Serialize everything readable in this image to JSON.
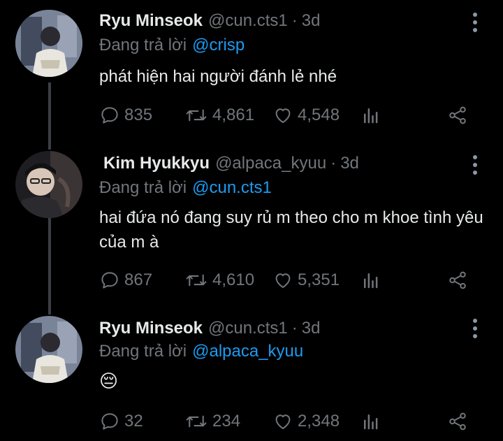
{
  "colors": {
    "background": "#000000",
    "text": "#e7e9ea",
    "muted": "#71767b",
    "mention": "#1d9bf0",
    "thread_line": "#3b3f44"
  },
  "tweets": [
    {
      "display_name": "Ryu Minseok",
      "handle": "@cun.cts1",
      "separator": "·",
      "time": "3d",
      "reply_prefix": "Đang trả lời",
      "reply_to": "@crisp",
      "text": "phát hiện hai người đánh lẻ nhé",
      "replies": "835",
      "retweets": "4,861",
      "likes": "4,548",
      "icons": [
        "reply-icon",
        "retweet-icon",
        "like-icon",
        "stats-icon",
        "share-icon",
        "more-icon"
      ]
    },
    {
      "display_name": "Kim Hyukkyu",
      "handle": "@alpaca_kyuu",
      "separator": "·",
      "time": "3d",
      "reply_prefix": "Đang trả lời",
      "reply_to": "@cun.cts1",
      "text": "hai đứa nó đang suy rủ m theo cho m khoe tình yêu của m à",
      "replies": "867",
      "retweets": "4,610",
      "likes": "5,351",
      "icons": [
        "reply-icon",
        "retweet-icon",
        "like-icon",
        "stats-icon",
        "share-icon",
        "more-icon"
      ]
    },
    {
      "display_name": "Ryu Minseok",
      "handle": "@cun.cts1",
      "separator": "·",
      "time": "3d",
      "reply_prefix": "Đang trả lời",
      "reply_to": "@alpaca_kyuu",
      "text": "😔",
      "replies": "32",
      "retweets": "234",
      "likes": "2,348",
      "icons": [
        "reply-icon",
        "retweet-icon",
        "like-icon",
        "stats-icon",
        "share-icon",
        "more-icon"
      ]
    }
  ]
}
